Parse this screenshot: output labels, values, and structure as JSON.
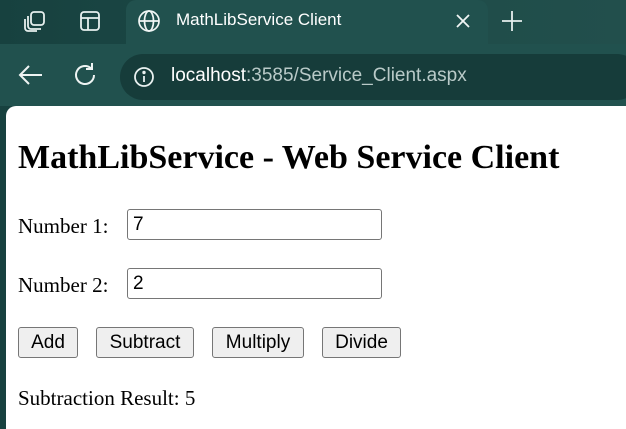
{
  "browser": {
    "tab": {
      "title": "MathLibService Client"
    },
    "address_bar": {
      "host": "localhost",
      "path": ":3585/Service_Client.aspx"
    },
    "icons": {
      "workspaces": "workspaces-icon",
      "tab_actions": "tab-actions-icon",
      "site": "globe-icon",
      "close": "close-icon",
      "new_tab": "plus-icon",
      "back": "back-arrow-icon",
      "refresh": "refresh-icon",
      "site_info": "info-icon"
    }
  },
  "page": {
    "heading": "MathLibService - Web Service Client",
    "fields": [
      {
        "label": "Number 1:",
        "value": "7"
      },
      {
        "label": "Number 2:",
        "value": "2"
      }
    ],
    "buttons": {
      "add": "Add",
      "subtract": "Subtract",
      "multiply": "Multiply",
      "divide": "Divide"
    },
    "result": {
      "label": "Subtraction Result:",
      "value": "5"
    }
  },
  "colors": {
    "chrome_dark": "#17413f",
    "chrome_tab": "#21514e",
    "omnibox": "#163c3a",
    "page_bg": "#ffffff"
  }
}
